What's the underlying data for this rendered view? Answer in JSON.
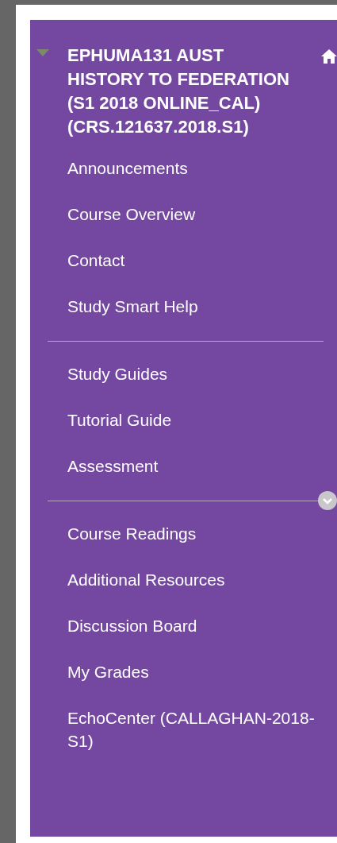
{
  "course_menu": {
    "title": "EPHUMA131 AUST HISTORY TO FEDERATION (S1 2018 ONLINE_CAL) (CRS.121637.2018.S1)",
    "expanded": true,
    "sections": [
      {
        "items": [
          "Announcements",
          "Course Overview",
          "Contact",
          "Study Smart Help"
        ]
      },
      {
        "items": [
          "Study Guides",
          "Tutorial Guide",
          "Assessment"
        ]
      },
      {
        "items": [
          "Course Readings",
          "Additional Resources",
          "Discussion Board",
          "My Grades",
          "EchoCenter (CALLAGHAN-2018-S1)"
        ]
      }
    ]
  }
}
